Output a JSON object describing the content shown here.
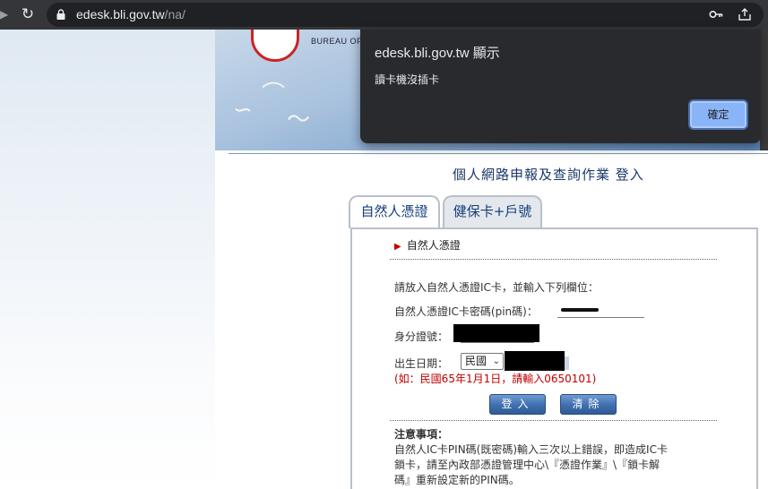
{
  "browser": {
    "url_host": "edesk.bli.gov.tw",
    "url_path": "/na/"
  },
  "banner": {
    "logo_text": "BUREAU OF LA"
  },
  "dialog": {
    "title": "edesk.bli.gov.tw 顯示",
    "message": "讀卡機沒插卡",
    "ok_label": "確定"
  },
  "page": {
    "heading": "個人網路申報及查詢作業 登入"
  },
  "tabs": [
    {
      "label": "自然人憑證",
      "active": true
    },
    {
      "label": "健保卡+戶號",
      "active": false
    }
  ],
  "form": {
    "section_title": "自然人憑證",
    "instruction": "請放入自然人憑證IC卡，並輸入下列欄位：",
    "pin_label": "自然人憑證IC卡密碼(pin碼)：",
    "id_label": "身分證號：",
    "birth_label": "出生日期：",
    "era_value": "民國",
    "hint": "(如：民國65年1月1日，請輸入0650101)",
    "login_label": "登入",
    "clear_label": "清除"
  },
  "notes": {
    "title": "注意事項：",
    "line1": "自然人IC卡PIN碼(既密碼)輸入三次以上錯誤，即造成IC卡",
    "line2": "鎖卡，請至內政部憑證管理中心\\『憑證作業』\\『鎖卡解",
    "line3": "碼』重新設定新的PIN碼。"
  }
}
